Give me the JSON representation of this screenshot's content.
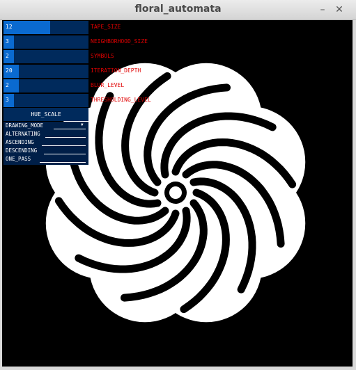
{
  "window": {
    "title": "floral_automata",
    "minimize_glyph": "–",
    "close_glyph": "✕"
  },
  "gui": {
    "sliders": [
      {
        "value": "12",
        "label": "TAPE_SIZE",
        "fill": 0.55
      },
      {
        "value": "3",
        "label": "NEIGHBORHOOD_SIZE",
        "fill": 0.1
      },
      {
        "value": "2",
        "label": "SYMBOLS",
        "fill": 0.0
      },
      {
        "value": "20",
        "label": "ITERATION_DEPTH",
        "fill": 0.18
      },
      {
        "value": "2",
        "label": "BLUR_LEVEL",
        "fill": 0.18
      },
      {
        "value": "3",
        "label": "THRESHOLDING_LEVEL",
        "fill": 0.12
      }
    ],
    "hue_button": "HUE_SCALE",
    "dropdown": {
      "selected": "DRAWING_MODE",
      "options": [
        "ALTERNATING",
        "ASCENDING",
        "DESCENDING",
        "ONE_PASS"
      ]
    }
  },
  "colors": {
    "slider_bg": "#002a5c",
    "slider_fill": "#0a6ad0",
    "label_red": "#e00000",
    "canvas": "#000000",
    "pattern": "#ffffff"
  }
}
